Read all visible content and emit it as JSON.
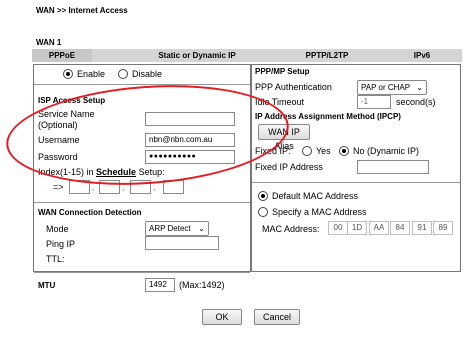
{
  "breadcrumb": "WAN >> Internet Access",
  "section_title": "WAN 1",
  "tabs": [
    {
      "label": "PPPoE",
      "active": true
    },
    {
      "label": "Static or Dynamic IP",
      "active": false
    },
    {
      "label": "PPTP/L2TP",
      "active": false
    },
    {
      "label": "IPv6",
      "active": false
    }
  ],
  "left": {
    "enable_label": "Enable",
    "disable_label": "Disable",
    "isp_header": "ISP Access Setup",
    "service_name_label": "Service Name",
    "service_name_optional": "(Optional)",
    "service_name_value": "",
    "username_label": "Username",
    "username_value": "nbn@nbn.com.au",
    "password_label": "Password",
    "password_value": "●●●●●●●●●●",
    "index_label_pre": "Index(1-15) in",
    "index_label_link": "Schedule",
    "index_label_post": "Setup:",
    "index_arrow": "=>",
    "index_sep": ",",
    "wan_detect_header": "WAN Connection Detection",
    "mode_label": "Mode",
    "mode_value": "ARP Detect",
    "ping_ip_label": "Ping IP",
    "ttl_label": "TTL:",
    "mtu_label": "MTU",
    "mtu_value": "1492",
    "mtu_max": "(Max:1492)"
  },
  "right": {
    "ppp_header": "PPP/MP Setup",
    "ppp_auth_label": "PPP Authentication",
    "ppp_auth_value": "PAP or CHAP",
    "idle_label": "Idle Timeout",
    "idle_value": "-1",
    "idle_unit": "second(s)",
    "ipcp_header": "IP Address Assignment Method (IPCP)",
    "wan_ip_alias_label": "WAN IP Alias",
    "fixed_ip_label": "Fixed IP:",
    "yes_label": "Yes",
    "no_label": "No (Dynamic IP)",
    "fixed_ip_address_label": "Fixed IP Address",
    "default_mac_label": "Default MAC Address",
    "specify_mac_label": "Specify a MAC Address",
    "mac_address_label": "MAC Address:",
    "mac_octets": [
      "00",
      "1D",
      "AA",
      "84",
      "91",
      "89"
    ],
    "mac_sep": "·"
  },
  "footer": {
    "ok_label": "OK",
    "cancel_label": "Cancel"
  },
  "colors": {
    "annotation": "#e31b23",
    "tab_bg": "#d4d4d4",
    "link": "#000000"
  }
}
